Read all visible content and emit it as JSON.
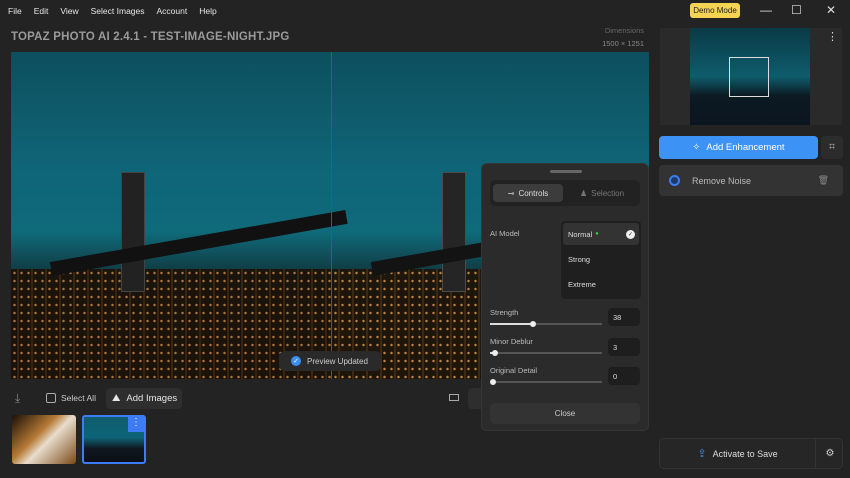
{
  "menu": [
    "File",
    "Edit",
    "View",
    "Select Images",
    "Account",
    "Help"
  ],
  "demo_mode": "Demo Mode",
  "window": {
    "minimize": "—",
    "maximize": "☐",
    "close": "✕"
  },
  "title": "TOPAZ PHOTO AI 2.4.1 - TEST-IMAGE-NIGHT.JPG",
  "dimensions": {
    "label": "Dimensions",
    "value": "1500 × 1251"
  },
  "toast": "Preview Updated",
  "bottom": {
    "select_all": "Select All",
    "add_images": "Add Images"
  },
  "panel": {
    "tabs": [
      "Controls",
      "Selection"
    ],
    "ai_model_label": "AI Model",
    "models": [
      "Normal",
      "Strong",
      "Extreme"
    ],
    "selected_model": "Normal",
    "sliders": [
      {
        "label": "Strength",
        "value": "38"
      },
      {
        "label": "Minor Deblur",
        "value": "3"
      },
      {
        "label": "Original Detail",
        "value": "0"
      }
    ],
    "close": "Close"
  },
  "right": {
    "add_enhancement": "Add Enhancement",
    "enhancement": "Remove Noise",
    "activate": "Activate to Save"
  },
  "colors": {
    "accent": "#3d92f5",
    "demo": "#f5d453"
  }
}
